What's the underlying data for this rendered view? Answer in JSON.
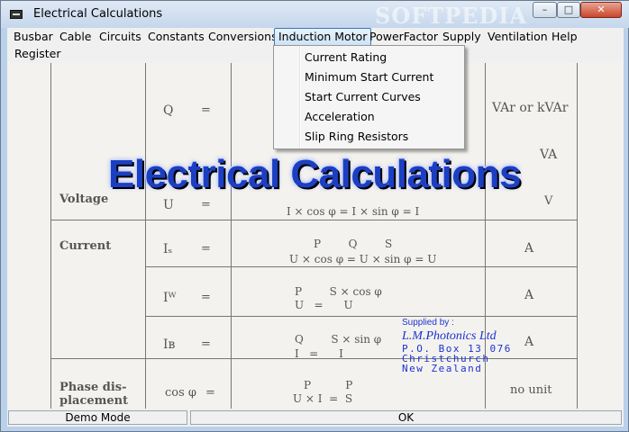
{
  "window": {
    "title": "Electrical Calculations",
    "watermark": "SOFTPEDIA",
    "buttons": {
      "minimize": "–",
      "maximize": "□",
      "close": "✕"
    }
  },
  "menu": {
    "items": [
      "Busbar",
      "Cable",
      "Circuits",
      "Constants",
      "Conversions",
      "Induction Motor",
      "PowerFactor",
      "Supply",
      "Ventilation",
      "Help"
    ],
    "register": "Register",
    "active": "Induction Motor"
  },
  "dropdown": {
    "items": [
      "Current Rating",
      "Minimum Start Current",
      "Start Current Curves",
      "Acceleration",
      "Slip Ring Resistors"
    ]
  },
  "background": {
    "big_title": "Electrical Calculations",
    "labels": {
      "voltage": "Voltage",
      "current": "Current",
      "phase1": "Phase dis-",
      "phase2": "placement"
    },
    "symbols": {
      "q": "Q",
      "u": "U",
      "is": "Iₛ",
      "iw": "Iᵂ",
      "ib": "Iʙ",
      "cos": "cos φ",
      "eq": "="
    },
    "units": {
      "var": "VAr or kVAr",
      "va": "VA",
      "v": "V",
      "a1": "A",
      "a2": "A",
      "a3": "A",
      "nounit": "no unit"
    },
    "formulas": {
      "f_u": "I × cos φ  =  I × sin φ  =  I",
      "f_is_num": "P        Q        S",
      "f_is_den": "U × cos φ  =  U × sin φ  =  U",
      "f_iw_num": "P        S × cos φ",
      "f_iw_den": "U   =      U",
      "f_ib_num": "Q        S × sin φ",
      "f_ib_den": "I   =      I",
      "f_cos_num": "P          P",
      "f_cos_den": "U × I  =  S"
    }
  },
  "supplied": {
    "label": "Supplied by :",
    "company": "L.M.Photonics Ltd",
    "address1": "P.O. Box 13 076",
    "address2": "Christchurch",
    "address3": "New Zealand"
  },
  "status": {
    "mode": "Demo Mode",
    "ok": "OK"
  }
}
